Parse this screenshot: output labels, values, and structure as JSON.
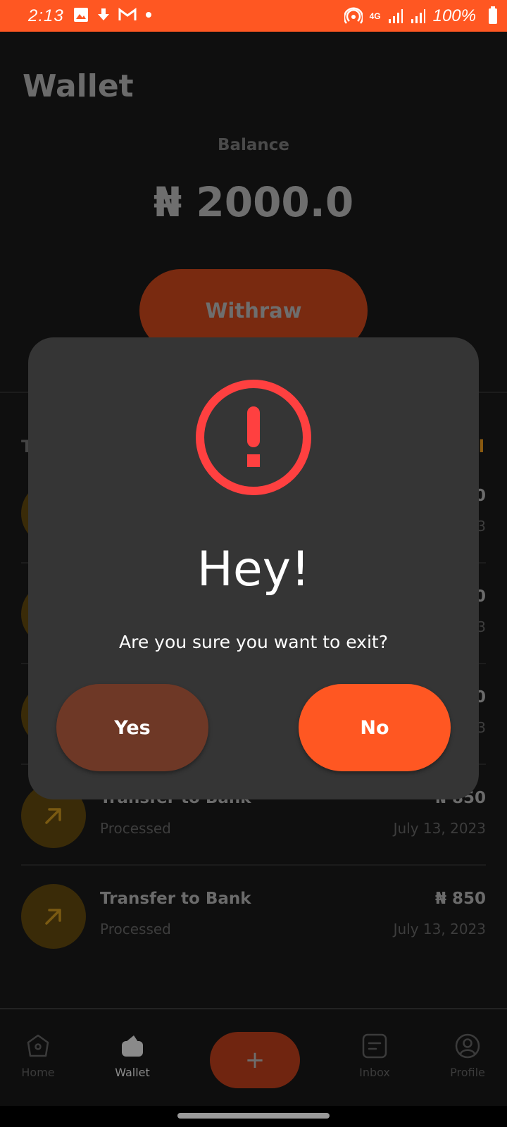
{
  "status_bar": {
    "time": "2:13",
    "battery_percent": "100%",
    "network_label": "4G",
    "icons": [
      "image-icon",
      "download-icon",
      "gmail-icon",
      "dot-icon",
      "hotspot-icon",
      "signal-icon",
      "signal-icon",
      "battery-icon"
    ]
  },
  "colors": {
    "accent": "#ff5722",
    "alert_red": "#ff4040",
    "dialog_bg": "#353535",
    "yes_button": "#6e3826"
  },
  "wallet": {
    "title": "Wallet",
    "balance_label": "Balance",
    "balance_amount": "₦ 2000.0",
    "withdraw_label": "Withraw"
  },
  "transactions": {
    "section_title": "T",
    "see_all": "l",
    "visible_rows": [
      {
        "title": "Transfer to Bank",
        "status": "Processed",
        "amount": "₦ 850",
        "date": "July 13, 2023"
      },
      {
        "title": "Transfer to Bank",
        "status": "Processed",
        "amount": "₦ 850",
        "date": "July 13, 2023"
      }
    ],
    "obscured_rows": [
      {
        "amount_tail": "0",
        "date_tail": "3"
      },
      {
        "amount_tail": "0",
        "date_tail": "3"
      },
      {
        "amount_tail": "0",
        "date_tail": "3"
      }
    ]
  },
  "dialog": {
    "icon": "alert-circle-icon",
    "title": "Hey!",
    "message": "Are you sure you want to exit?",
    "yes_label": "Yes",
    "no_label": "No"
  },
  "bottom_nav": {
    "items": [
      {
        "label": "Home",
        "icon": "home-icon"
      },
      {
        "label": "Wallet",
        "icon": "wallet-icon",
        "active": true
      },
      {
        "label": "Inbox",
        "icon": "inbox-icon"
      },
      {
        "label": "Profile",
        "icon": "profile-icon"
      }
    ],
    "fab_label": "+"
  }
}
